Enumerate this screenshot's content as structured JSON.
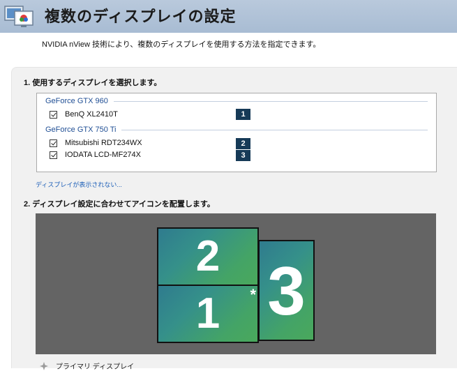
{
  "header": {
    "title": "複数のディスプレイの設定",
    "icon": "multi-display-settings-icon"
  },
  "subtitle": "NVIDIA nView 技術により、複数のディスプレイを使用する方法を指定できます。",
  "section1": {
    "title": "1. 使用するディスプレイを選択します。",
    "groups": [
      {
        "gpu": "GeForce GTX 960",
        "displays": [
          {
            "name": "BenQ XL2410T",
            "number": "1",
            "checked": true
          }
        ]
      },
      {
        "gpu": "GeForce GTX 750 Ti",
        "displays": [
          {
            "name": "Mitsubishi RDT234WX",
            "number": "2",
            "checked": true
          },
          {
            "name": "IODATA LCD-MF274X",
            "number": "3",
            "checked": true
          }
        ]
      }
    ],
    "missing_link": "ディスプレイが表示されない..."
  },
  "section2": {
    "title": "2. ディスプレイ設定に合わせてアイコンを配置します。",
    "monitors": [
      {
        "label": "2",
        "primary": false
      },
      {
        "label": "1",
        "primary": true,
        "primary_mark": "*"
      },
      {
        "label": "3",
        "primary": false
      }
    ]
  },
  "legend": {
    "text": "プライマリ ディスプレイ",
    "icon": "primary-display-icon"
  },
  "colors": {
    "header_bg": "#a8bcd3",
    "gpu_text": "#1f4e94",
    "badge_bg": "#163a57",
    "canvas_bg": "#646464",
    "monitor_gradient_start": "#2f7b8e",
    "monitor_gradient_end": "#4aa85c",
    "link": "#1a5db7"
  }
}
